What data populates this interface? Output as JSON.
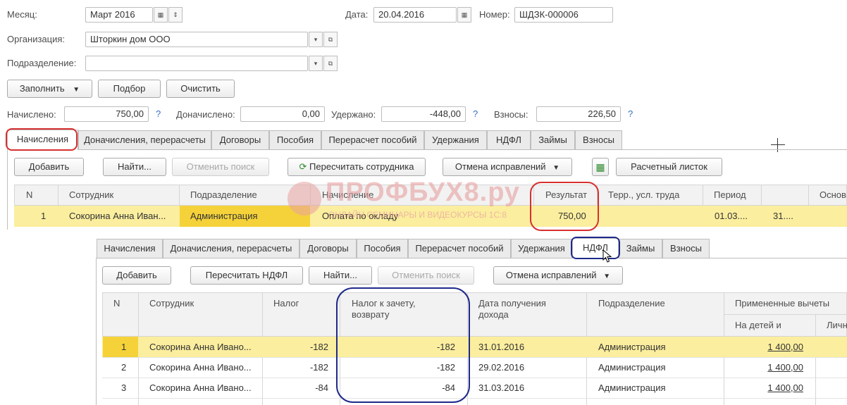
{
  "header": {
    "month_label": "Месяц:",
    "month_value": "Март 2016",
    "date_label": "Дата:",
    "date_value": "20.04.2016",
    "number_label": "Номер:",
    "number_value": "ШДЗК-000006",
    "org_label": "Организация:",
    "org_value": "Шторкин дом ООО",
    "dept_label": "Подразделение:",
    "dept_value": ""
  },
  "toolbar": {
    "fill": "Заполнить",
    "select": "Подбор",
    "clear": "Очистить"
  },
  "totals": {
    "accrued_label": "Начислено:",
    "accrued_value": "750,00",
    "extra_label": "Доначислено:",
    "extra_value": "0,00",
    "withheld_label": "Удержано:",
    "withheld_value": "-448,00",
    "contrib_label": "Взносы:",
    "contrib_value": "226,50",
    "help": "?"
  },
  "tabs": [
    "Начисления",
    "Доначисления, перерасчеты",
    "Договоры",
    "Пособия",
    "Перерасчет пособий",
    "Удержания",
    "НДФЛ",
    "Займы",
    "Взносы"
  ],
  "accruals": {
    "add": "Добавить",
    "find": "Найти...",
    "cancel_search": "Отменить поиск",
    "recalc_employee": "Пересчитать сотрудника",
    "cancel_corrections": "Отмена исправлений",
    "payslip": "Расчетный листок",
    "columns": [
      "N",
      "Сотрудник",
      "Подразделение",
      "Начисление",
      "Результат",
      "Терр., усл. труда",
      "Период",
      "",
      "Основ"
    ],
    "row": {
      "n": "1",
      "employee": "Сокорина Анна Иван...",
      "dept": "Администрация",
      "accrual": "Оплата по окладу",
      "result": "750,00",
      "period": "01.03....",
      "period_end": "31...."
    }
  },
  "watermark": {
    "brand": "ПРОФБУХ8.ру",
    "tagline": "ОНЛАЙН СЕМИНАРЫ И ВИДЕОКУРСЫ 1С:8"
  },
  "ndfl": {
    "add": "Добавить",
    "recalc_ndfl": "Пересчитать НДФЛ",
    "find": "Найти...",
    "cancel_search": "Отменить поиск",
    "cancel_corrections": "Отмена исправлений",
    "columns": {
      "n": "N",
      "employee": "Сотрудник",
      "tax": "Налог",
      "tax_offset_1": "Налог к зачету,",
      "tax_offset_2": "возврату",
      "income_date_1": "Дата получения",
      "income_date_2": "дохода",
      "dept": "Подразделение",
      "deductions": "Примененные вычеты",
      "children": "На детей и",
      "personal": "Личн"
    },
    "rows": [
      {
        "n": "1",
        "employee": "Сокорина Анна Ивано...",
        "tax": "-182",
        "offset": "-182",
        "date": "31.01.2016",
        "dept": "Администрация",
        "children": "1 400,00"
      },
      {
        "n": "2",
        "employee": "Сокорина Анна Ивано...",
        "tax": "-182",
        "offset": "-182",
        "date": "29.02.2016",
        "dept": "Администрация",
        "children": "1 400,00"
      },
      {
        "n": "3",
        "employee": "Сокорина Анна Ивано...",
        "tax": "-84",
        "offset": "-84",
        "date": "31.03.2016",
        "dept": "Администрация",
        "children": "1 400,00"
      }
    ]
  },
  "colors": {
    "selected_row": "#fbee9e",
    "dept_cell": "#f5d23a",
    "red_annotation": "#d63030",
    "blue_annotation": "#1f2a8a",
    "watermark": "#e8a0a0"
  }
}
